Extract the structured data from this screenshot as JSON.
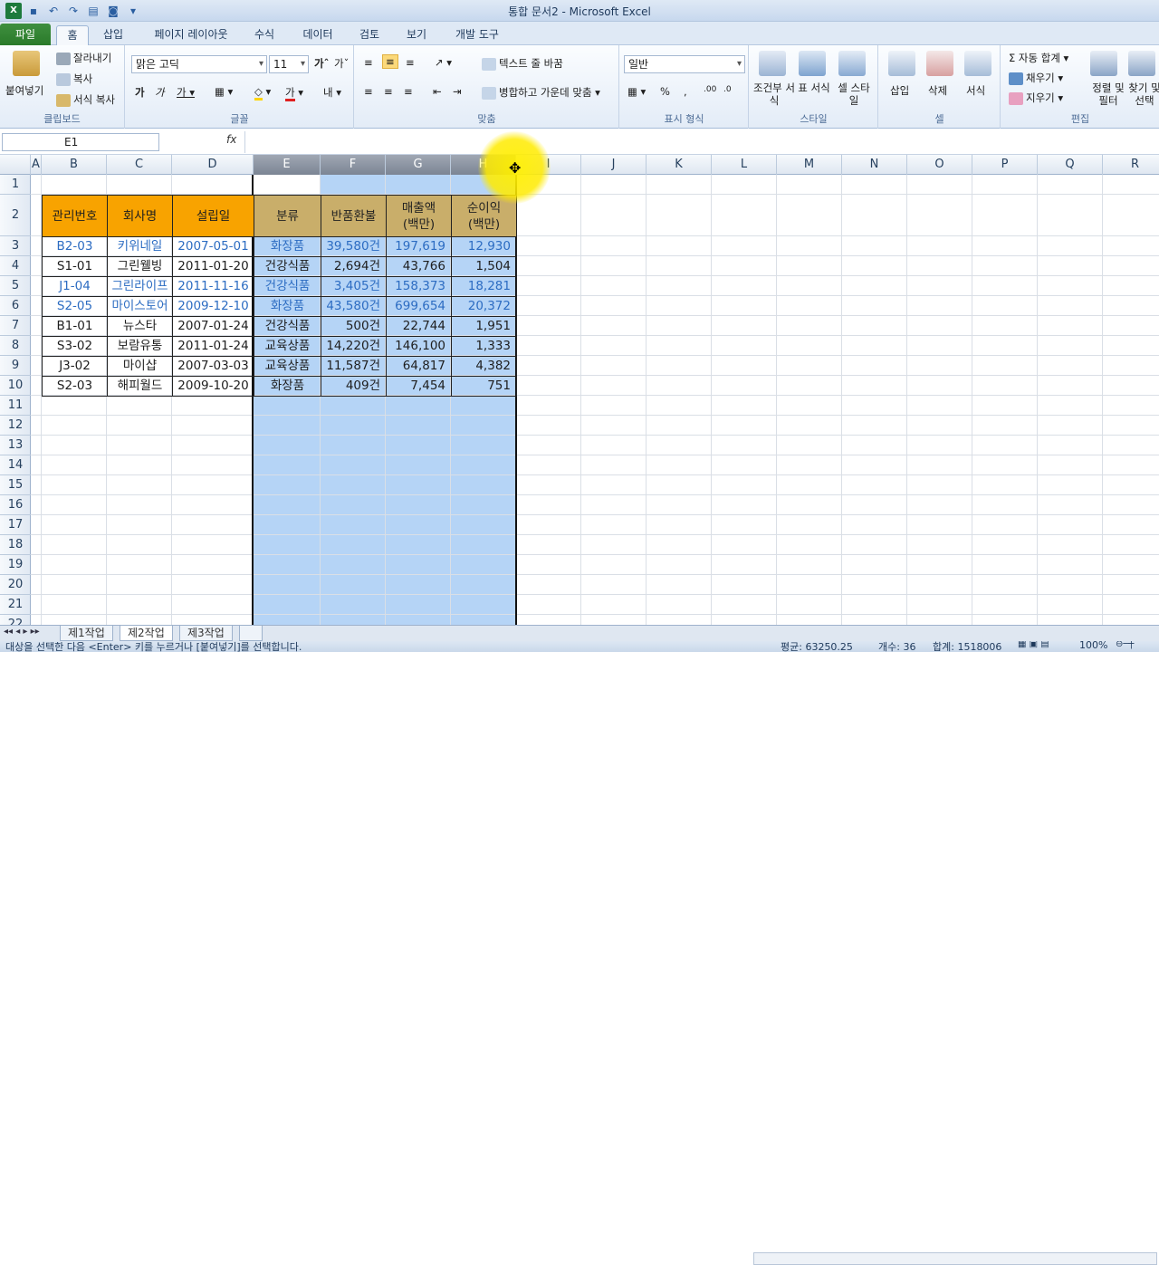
{
  "window": {
    "title": "통합 문서2 - Microsoft Excel"
  },
  "tabs": [
    {
      "label": "파일"
    },
    {
      "label": "홈"
    },
    {
      "label": "삽입"
    },
    {
      "label": "페이지 레이아웃"
    },
    {
      "label": "수식"
    },
    {
      "label": "데이터"
    },
    {
      "label": "검토"
    },
    {
      "label": "보기"
    },
    {
      "label": "개발 도구"
    }
  ],
  "ribbon": {
    "clipboard": {
      "label": "클립보드",
      "paste": "붙여넣기",
      "cut": "잘라내기",
      "copy": "복사",
      "format_painter": "서식 복사"
    },
    "font": {
      "label": "글꼴",
      "font_name": "맑은 고딕",
      "font_size": "11"
    },
    "align": {
      "label": "맞춤",
      "wrap_text": "텍스트 줄 바꿈",
      "merge_center": "병합하고 가운데 맞춤"
    },
    "number": {
      "label": "표시 형식",
      "format": "일반"
    },
    "styles": {
      "label": "스타일",
      "conditional": "조건부 서식",
      "table": "표 서식",
      "cell": "셀 스타일"
    },
    "cells": {
      "label": "셀",
      "insert": "삽입",
      "delete": "삭제",
      "format": "서식"
    },
    "editing": {
      "label": "편집",
      "autosum": "자동 합계",
      "fill": "채우기",
      "clear": "지우기",
      "sort_filter": "정렬 및 필터",
      "find_select": "찾기 및 선택"
    }
  },
  "formula_bar": {
    "name_box": "E1",
    "fx": "fx",
    "formula": ""
  },
  "columns": [
    "A",
    "B",
    "C",
    "D",
    "E",
    "F",
    "G",
    "H",
    "I",
    "J",
    "K",
    "L",
    "M",
    "N",
    "O",
    "P",
    "Q",
    "R"
  ],
  "rows": [
    "1",
    "2",
    "3",
    "4",
    "5",
    "6",
    "7",
    "8",
    "9",
    "10",
    "11",
    "12",
    "13",
    "14",
    "15",
    "16",
    "17",
    "18",
    "19",
    "20",
    "21",
    "22"
  ],
  "table": {
    "headers": [
      "관리번호",
      "회사명",
      "설립일",
      "분류",
      "반품환불",
      "매출액\n(백만)",
      "순이익\n(백만)"
    ],
    "rows": [
      [
        "B2-03",
        "키위네일",
        "2007-05-01",
        "화장품",
        "39,580건",
        "197,619",
        "12,930"
      ],
      [
        "S1-01",
        "그린웰빙",
        "2011-01-20",
        "건강식품",
        "2,694건",
        "43,766",
        "1,504"
      ],
      [
        "J1-04",
        "그린라이프",
        "2011-11-16",
        "건강식품",
        "3,405건",
        "158,373",
        "18,281"
      ],
      [
        "S2-05",
        "마이스토어",
        "2009-12-10",
        "화장품",
        "43,580건",
        "699,654",
        "20,372"
      ],
      [
        "B1-01",
        "뉴스타",
        "2007-01-24",
        "건강식품",
        "500건",
        "22,744",
        "1,951"
      ],
      [
        "S3-02",
        "보람유통",
        "2011-01-24",
        "교육상품",
        "14,220건",
        "146,100",
        "1,333"
      ],
      [
        "J3-02",
        "마이샵",
        "2007-03-03",
        "교육상품",
        "11,587건",
        "64,817",
        "4,382"
      ],
      [
        "S2-03",
        "해피월드",
        "2009-10-20",
        "화장품",
        "409건",
        "7,454",
        "751"
      ]
    ]
  },
  "sheets": [
    {
      "label": "제1작업"
    },
    {
      "label": "제2작업"
    },
    {
      "label": "제3작업"
    }
  ],
  "status": {
    "message": "대상을 선택한 다음 <Enter> 키를 누르거나 [붙여넣기]를 선택합니다.",
    "average": "평균: 63250.25",
    "count": "개수: 36",
    "sum": "합계: 1518006",
    "zoom": "100%"
  },
  "colors": {
    "header_fill": "#f8a300",
    "selection": "#b5d4f6",
    "file_tab": "#2a7a2a"
  }
}
